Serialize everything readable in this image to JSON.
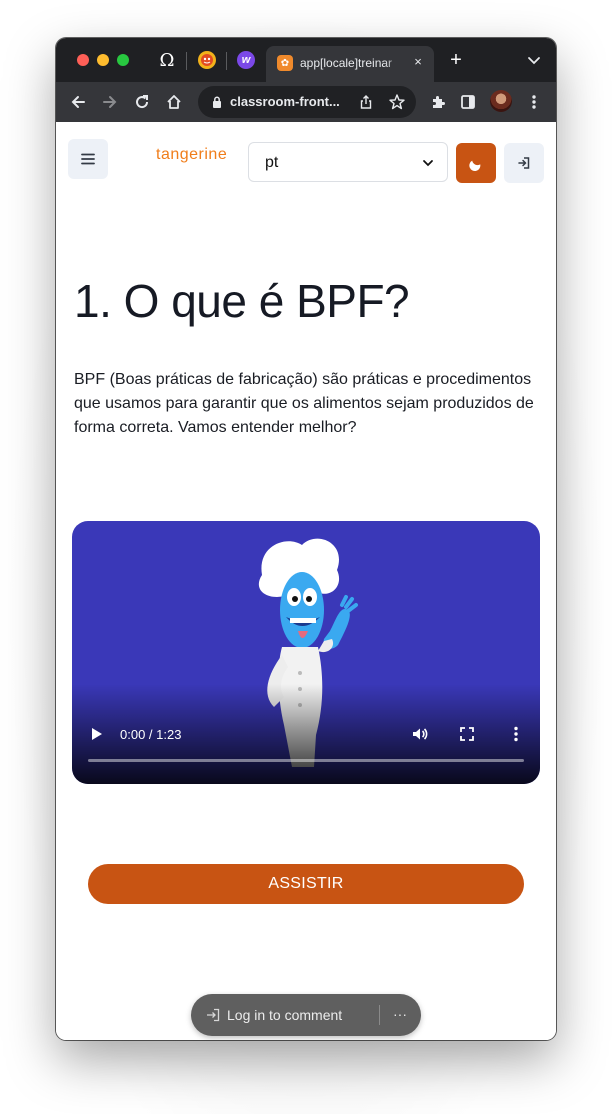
{
  "browser": {
    "pinned_tabs": [
      {
        "icon": "omega-icon",
        "glyph": "Ω"
      },
      {
        "icon": "tiger-icon"
      },
      {
        "icon": "w-logo-icon",
        "glyph": "w"
      }
    ],
    "active_tab": {
      "title": "app[locale]treinar",
      "close": "×"
    },
    "new_tab": "+",
    "address": "classroom-front..."
  },
  "header": {
    "logo": "tangerine",
    "language": {
      "selected": "pt"
    }
  },
  "lesson": {
    "title": "1. O que é BPF?",
    "description": "BPF (Boas práticas de fabricação) são práticas e procedimentos que usamos para garantir que os alimentos sejam produzidos de forma correta. Vamos entender melhor?"
  },
  "video": {
    "time": "0:00 / 1:23",
    "progress": 0
  },
  "cta": {
    "label": "ASSISTIR"
  },
  "comments": {
    "label": "Log in to comment",
    "more": "···"
  },
  "colors": {
    "accent": "#c85413",
    "logo": "#f07d1a",
    "video_bg": "#3a38b8"
  }
}
